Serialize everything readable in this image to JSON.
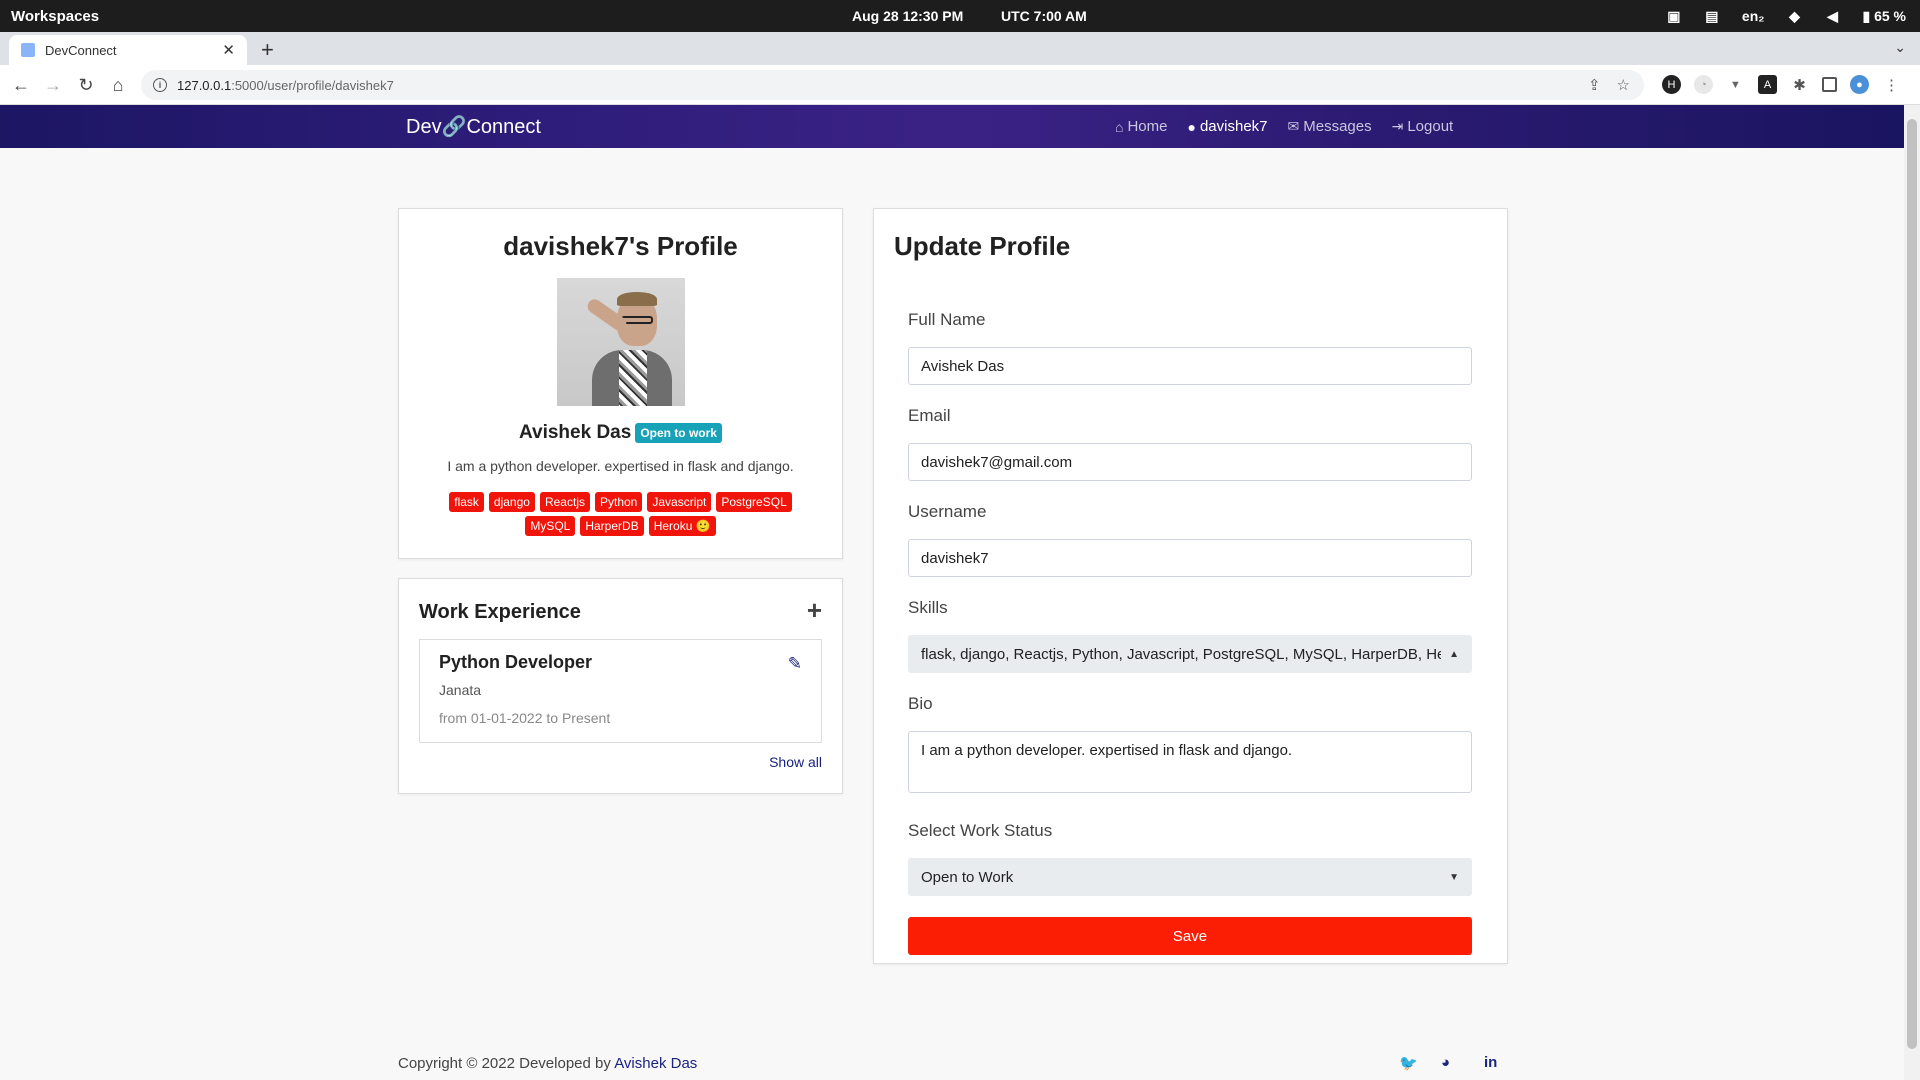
{
  "os": {
    "workspaces": "Workspaces",
    "clock": "Aug 28  12:30 PM",
    "utc": "UTC  7:00 AM",
    "lang": "en₂",
    "battery": "65 %"
  },
  "browser": {
    "tab_title": "DevConnect",
    "url_host": "127.0.0.1",
    "url_path": ":5000/user/profile/davishek7"
  },
  "nav": {
    "brand_left": "Dev",
    "brand_right": "Connect",
    "home": "Home",
    "user": "davishek7",
    "messages": "Messages",
    "logout": "Logout"
  },
  "profile": {
    "title": "davishek7's Profile",
    "name": "Avishek Das",
    "status": "Open to work",
    "bio": "I am a python developer. expertised in flask and django.",
    "skills": [
      "flask",
      "django",
      "Reactjs",
      "Python",
      "Javascript",
      "PostgreSQL",
      "MySQL",
      "HarperDB",
      "Heroku 🙂"
    ]
  },
  "work": {
    "title": "Work Experience",
    "job_title": "Python Developer",
    "company": "Janata",
    "period": "from 01-01-2022 to Present",
    "show_all": "Show all"
  },
  "form": {
    "title": "Update Profile",
    "full_name_label": "Full Name",
    "full_name_value": "Avishek Das",
    "email_label": "Email",
    "email_value": "davishek7@gmail.com",
    "username_label": "Username",
    "username_value": "davishek7",
    "skills_label": "Skills",
    "skills_value": "flask, django, Reactjs, Python, Javascript, PostgreSQL, MySQL, HarperDB, Heroku",
    "bio_label": "Bio",
    "bio_value": "I am a python developer. expertised in flask and django.",
    "status_label": "Select Work Status",
    "status_value": "Open to Work",
    "save_label": "Save"
  },
  "footer": {
    "text": "Copyright © 2022 Developed by ",
    "author": "Avishek Das"
  },
  "colors": {
    "navbar": "#2c1c78",
    "accent_red": "#fc1e04",
    "status_teal": "#17a2b8",
    "link_navy": "#1a237e"
  }
}
